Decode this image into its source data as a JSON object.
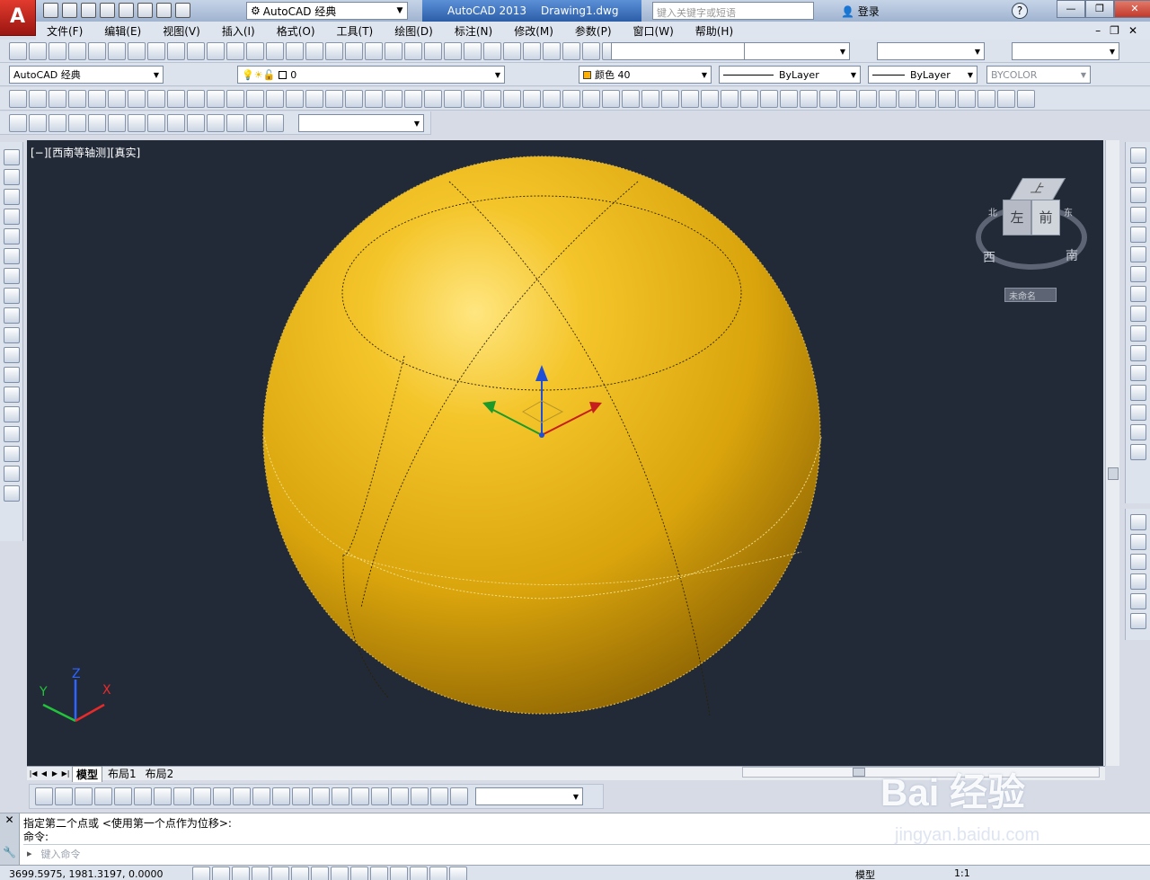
{
  "title_bar": {
    "app_logo": "A",
    "workspace": "AutoCAD 经典",
    "app_name": "AutoCAD 2013",
    "document": "Drawing1.dwg",
    "search_placeholder": "键入关键字或短语",
    "login": "登录",
    "help": "?"
  },
  "menu": {
    "items": [
      "文件(F)",
      "编辑(E)",
      "视图(V)",
      "插入(I)",
      "格式(O)",
      "工具(T)",
      "绘图(D)",
      "标注(N)",
      "修改(M)",
      "参数(P)",
      "窗口(W)",
      "帮助(H)"
    ]
  },
  "toolbar2": {
    "workspace_select": "AutoCAD 经典",
    "layer": "0",
    "color": "颜色 40",
    "linetype": "ByLayer",
    "lineweight": "ByLayer",
    "plotstyle": "BYCOLOR"
  },
  "viewport": {
    "label": "[−][西南等轴测][真实]",
    "viewcube_top": "上",
    "viewcube_left": "左",
    "viewcube_front": "前",
    "compass_w": "西",
    "compass_s": "南",
    "compass_n": "北",
    "compass_e": "东",
    "ucs_name": "未命名",
    "sphere_color": "#e0a90f",
    "background": "#222a38"
  },
  "ucs": {
    "x": "X",
    "y": "Y",
    "z": "Z"
  },
  "layout_tabs": [
    "模型",
    "布局1",
    "布局2"
  ],
  "command": {
    "history_line1": "指定第二个点或 <使用第一个点作为位移>:",
    "history_line2": "命令:",
    "input_placeholder": "键入命令"
  },
  "status": {
    "coords": "3699.5975,  1981.3197,  0.0000",
    "model": "模型",
    "scale": "1:1"
  },
  "watermark": {
    "brand": "Bai  经验",
    "url": "jingyan.baidu.com"
  }
}
